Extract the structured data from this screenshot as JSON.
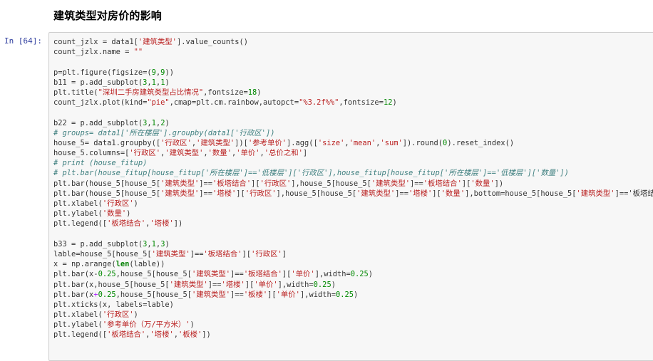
{
  "section_heading": "建筑类型对房价的影响",
  "cell_prompt": "In  [64]:",
  "code_lines": [
    [
      [
        "count_jzlx = data1[",
        ""
      ],
      [
        "'建筑类型'",
        "string"
      ],
      [
        "].value_counts()",
        ""
      ]
    ],
    [
      [
        "count_jzlx.name = ",
        ""
      ],
      [
        "\"\"",
        "string"
      ]
    ],
    [],
    [
      [
        "p=plt.figure(figsize=(",
        ""
      ],
      [
        "9",
        "number"
      ],
      [
        ",",
        ""
      ],
      [
        "9",
        "number"
      ],
      [
        "))",
        ""
      ]
    ],
    [
      [
        "b11 = p.add_subplot(",
        ""
      ],
      [
        "3",
        "number"
      ],
      [
        ",",
        ""
      ],
      [
        "1",
        "number"
      ],
      [
        ",",
        ""
      ],
      [
        "1",
        "number"
      ],
      [
        ")",
        ""
      ]
    ],
    [
      [
        "plt.title(",
        ""
      ],
      [
        "\"深圳二手房建筑类型占比情况\"",
        "string"
      ],
      [
        ",fontsize=",
        ""
      ],
      [
        "18",
        "number"
      ],
      [
        ")",
        ""
      ]
    ],
    [
      [
        "count_jzlx.plot(kind=",
        ""
      ],
      [
        "\"pie\"",
        "string"
      ],
      [
        ",cmap=plt.cm.rainbow,autopct=",
        ""
      ],
      [
        "\"%3.2f%%\"",
        "string"
      ],
      [
        ",fontsize=",
        ""
      ],
      [
        "12",
        "number"
      ],
      [
        ")",
        ""
      ]
    ],
    [],
    [
      [
        "b22 = p.add_subplot(",
        ""
      ],
      [
        "3",
        "number"
      ],
      [
        ",",
        ""
      ],
      [
        "1",
        "number"
      ],
      [
        ",",
        ""
      ],
      [
        "2",
        "number"
      ],
      [
        ")",
        ""
      ]
    ],
    [
      [
        "# groups= data1['所在楼层'].groupby(data1['行政区'])",
        "comment"
      ]
    ],
    [
      [
        "house_5= data1.groupby([",
        ""
      ],
      [
        "'行政区'",
        "string"
      ],
      [
        ",",
        ""
      ],
      [
        "'建筑类型'",
        "string"
      ],
      [
        "])[",
        ""
      ],
      [
        "'参考单价'",
        "string"
      ],
      [
        "].agg([",
        ""
      ],
      [
        "'size'",
        "string"
      ],
      [
        ",",
        ""
      ],
      [
        "'mean'",
        "string"
      ],
      [
        ",",
        ""
      ],
      [
        "'sum'",
        "string"
      ],
      [
        "]).round(",
        ""
      ],
      [
        "0",
        "number"
      ],
      [
        ").reset_index()",
        ""
      ]
    ],
    [
      [
        "house_5.columns=[",
        ""
      ],
      [
        "'行政区'",
        "string"
      ],
      [
        ",",
        ""
      ],
      [
        "'建筑类型'",
        "string"
      ],
      [
        ",",
        ""
      ],
      [
        "'数量'",
        "string"
      ],
      [
        ",",
        ""
      ],
      [
        "'单价'",
        "string"
      ],
      [
        ",",
        ""
      ],
      [
        "'总价之和'",
        "string"
      ],
      [
        "]",
        ""
      ]
    ],
    [
      [
        "# print (house_fitup)",
        "comment"
      ]
    ],
    [
      [
        "# plt.bar(house_fitup[house_fitup['所在楼层']=='低楼层']['行政区'],house_fitup[house_fitup['所在楼层']=='低楼层']['数量'])",
        "comment"
      ]
    ],
    [
      [
        "plt.bar(house_5[house_5[",
        ""
      ],
      [
        "'建筑类型'",
        "string"
      ],
      [
        "]==",
        ""
      ],
      [
        "'板塔结合'",
        "string"
      ],
      [
        "][",
        ""
      ],
      [
        "'行政区'",
        "string"
      ],
      [
        "],house_5[house_5[",
        ""
      ],
      [
        "'建筑类型'",
        "string"
      ],
      [
        "]==",
        ""
      ],
      [
        "'板塔结合'",
        "string"
      ],
      [
        "][",
        ""
      ],
      [
        "'数量'",
        "string"
      ],
      [
        "])",
        ""
      ]
    ],
    [
      [
        "plt.bar(house_5[house_5[",
        ""
      ],
      [
        "'建筑类型'",
        "string"
      ],
      [
        "]==",
        ""
      ],
      [
        "'塔楼'",
        "string"
      ],
      [
        "][",
        ""
      ],
      [
        "'行政区'",
        "string"
      ],
      [
        "],house_5[house_5[",
        ""
      ],
      [
        "'建筑类型'",
        "string"
      ],
      [
        "]==",
        ""
      ],
      [
        "'塔楼'",
        "string"
      ],
      [
        "][",
        ""
      ],
      [
        "'数量'",
        "string"
      ],
      [
        "],bottom=house_5[house_5[",
        ""
      ],
      [
        "'建筑类型'",
        "string"
      ],
      [
        "]==",
        ""
      ],
      [
        "'板塔结",
        ""
      ]
    ],
    [
      [
        "plt.xlabel(",
        ""
      ],
      [
        "'行政区'",
        "string"
      ],
      [
        ")",
        ""
      ]
    ],
    [
      [
        "plt.ylabel(",
        ""
      ],
      [
        "'数量'",
        "string"
      ],
      [
        ")",
        ""
      ]
    ],
    [
      [
        "plt.legend([",
        ""
      ],
      [
        "'板塔结合'",
        "string"
      ],
      [
        ",",
        ""
      ],
      [
        "'塔楼'",
        "string"
      ],
      [
        "])",
        ""
      ]
    ],
    [],
    [
      [
        "b33 = p.add_subplot(",
        ""
      ],
      [
        "3",
        "number"
      ],
      [
        ",",
        ""
      ],
      [
        "1",
        "number"
      ],
      [
        ",",
        ""
      ],
      [
        "3",
        "number"
      ],
      [
        ")",
        ""
      ]
    ],
    [
      [
        "lable=house_5[house_5[",
        ""
      ],
      [
        "'建筑类型'",
        "string"
      ],
      [
        "]==",
        ""
      ],
      [
        "'板塔结合'",
        "string"
      ],
      [
        "][",
        ""
      ],
      [
        "'行政区'",
        "string"
      ],
      [
        "]",
        ""
      ]
    ],
    [
      [
        "x = np.arange(",
        ""
      ],
      [
        "len",
        "kw"
      ],
      [
        "(lable))",
        ""
      ]
    ],
    [
      [
        "plt.bar(x-",
        ""
      ],
      [
        "0.25",
        "number"
      ],
      [
        ",house_5[house_5[",
        ""
      ],
      [
        "'建筑类型'",
        "string"
      ],
      [
        "]==",
        ""
      ],
      [
        "'板塔结合'",
        "string"
      ],
      [
        "][",
        ""
      ],
      [
        "'单价'",
        "string"
      ],
      [
        "],width=",
        ""
      ],
      [
        "0.25",
        "number"
      ],
      [
        ")",
        ""
      ]
    ],
    [
      [
        "plt.bar(x,house_5[house_5[",
        ""
      ],
      [
        "'建筑类型'",
        "string"
      ],
      [
        "]==",
        ""
      ],
      [
        "'塔楼'",
        "string"
      ],
      [
        "][",
        ""
      ],
      [
        "'单价'",
        "string"
      ],
      [
        "],width=",
        ""
      ],
      [
        "0.25",
        "number"
      ],
      [
        ")",
        ""
      ]
    ],
    [
      [
        "plt.bar(x",
        ""
      ],
      [
        "+",
        "op"
      ],
      [
        "0.25",
        "number"
      ],
      [
        ",house_5[house_5[",
        ""
      ],
      [
        "'建筑类型'",
        "string"
      ],
      [
        "]==",
        ""
      ],
      [
        "'板楼'",
        "string"
      ],
      [
        "][",
        ""
      ],
      [
        "'单价'",
        "string"
      ],
      [
        "],width=",
        ""
      ],
      [
        "0.25",
        "number"
      ],
      [
        ")",
        ""
      ]
    ],
    [
      [
        "plt.xticks(x, labels=lable)",
        ""
      ]
    ],
    [
      [
        "plt.xlabel(",
        ""
      ],
      [
        "'行政区'",
        "string"
      ],
      [
        ")",
        ""
      ]
    ],
    [
      [
        "plt.ylabel(",
        ""
      ],
      [
        "'参考单价（万/平方米）'",
        "string"
      ],
      [
        ")",
        ""
      ]
    ],
    [
      [
        "plt.legend([",
        ""
      ],
      [
        "'板塔结合'",
        "string"
      ],
      [
        ",",
        ""
      ],
      [
        "'塔楼'",
        "string"
      ],
      [
        ",",
        ""
      ],
      [
        "'板楼'",
        "string"
      ],
      [
        "])",
        ""
      ]
    ]
  ]
}
